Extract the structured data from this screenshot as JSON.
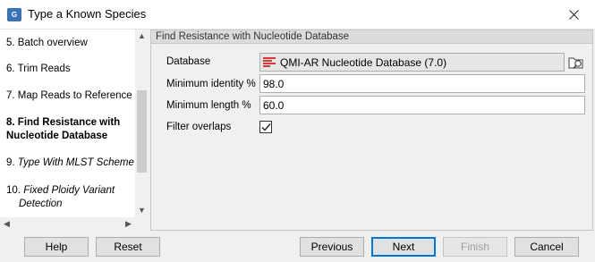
{
  "window": {
    "title": "Type a Known Species",
    "app_icon": "app-icon",
    "close_icon": "close-icon"
  },
  "steps": [
    {
      "num": "5.",
      "label": "Batch overview",
      "state": "done"
    },
    {
      "num": "6.",
      "label": "Trim Reads",
      "state": "done"
    },
    {
      "num": "7.",
      "label": "Map Reads to Reference",
      "state": "done"
    },
    {
      "num": "8.",
      "label_line1": "Find Resistance with",
      "label_line2": "Nucleotide Database",
      "state": "active"
    },
    {
      "num": "9.",
      "label": "Type With MLST Scheme",
      "state": "future"
    },
    {
      "num": "10.",
      "label_line1": "Fixed Ploidy Variant",
      "label_line2": "Detection",
      "state": "future"
    }
  ],
  "panel": {
    "title": "Find Resistance with Nucleotide Database",
    "database_label": "Database",
    "database_value": "QMI-AR Nucleotide Database (7.0)",
    "database_icon": "database-list-icon",
    "browse_icon": "browse-folder-icon",
    "min_identity_label": "Minimum identity %",
    "min_identity_value": "98.0",
    "min_length_label": "Minimum length %",
    "min_length_value": "60.0",
    "filter_overlaps_label": "Filter overlaps",
    "filter_overlaps_checked": true
  },
  "buttons": {
    "help": "Help",
    "reset": "Reset",
    "previous": "Previous",
    "next": "Next",
    "finish": "Finish",
    "cancel": "Cancel"
  },
  "colors": {
    "accent": "#0078d7",
    "db_icon": "#d43a3a"
  }
}
